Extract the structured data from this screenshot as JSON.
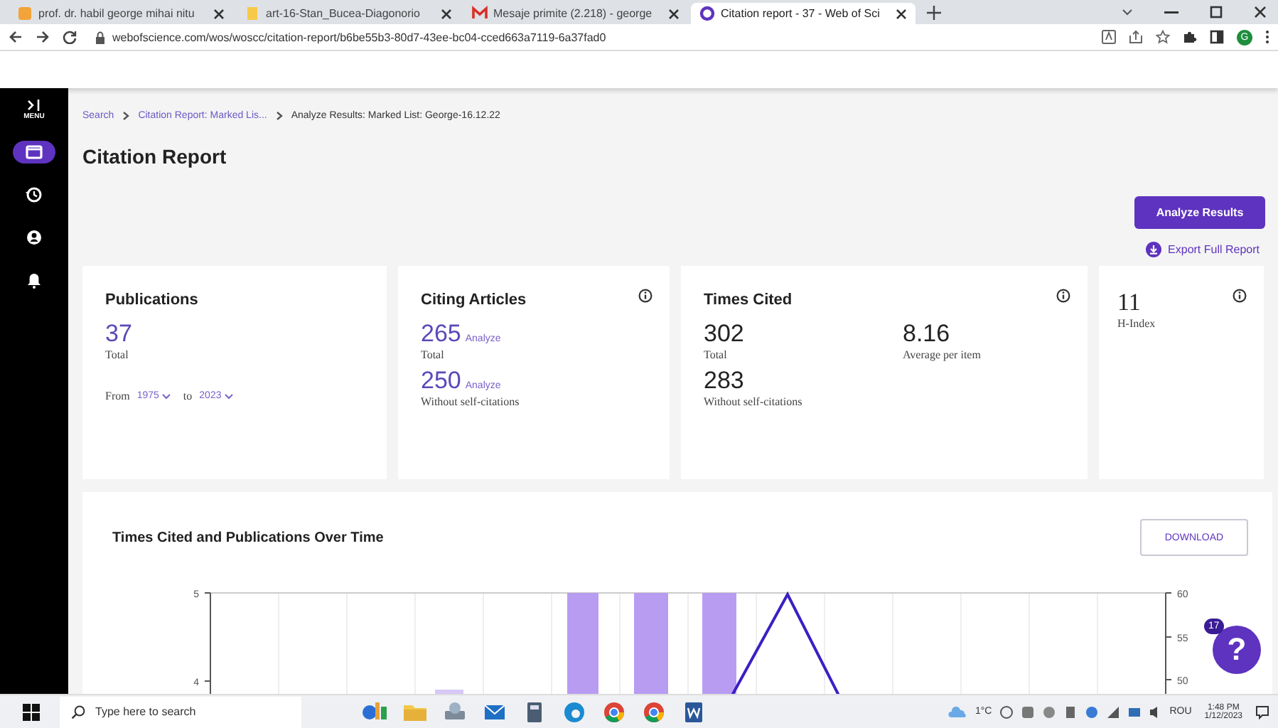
{
  "browser": {
    "tabs": [
      {
        "title": "prof. dr. habil george mihai nitu",
        "selected": false
      },
      {
        "title": "art-16-Stan_Bucea-Diagonorio",
        "selected": false
      },
      {
        "title": "Mesaje primite (2.218) - george",
        "selected": false
      },
      {
        "title": "Citation report - 37 - Web of Sci",
        "selected": true
      }
    ],
    "url": "webofscience.com/wos/woscc/citation-report/b6be55b3-80d7-43ee-bc04-cced663a7119-6a37fad0",
    "profile": "G"
  },
  "sidebar": {
    "menu_label": "MENU",
    "items": [
      {
        "kind": "folder",
        "selected": true
      },
      {
        "kind": "history",
        "selected": false
      },
      {
        "kind": "user",
        "selected": false
      },
      {
        "kind": "bell",
        "selected": false
      }
    ]
  },
  "breadcrumbs": [
    {
      "text": "Search",
      "link": true
    },
    {
      "text": "Citation Report: Marked Lis...",
      "link": true
    },
    {
      "text": "Analyze Results: Marked List: George-16.12.22",
      "link": false
    }
  ],
  "title": "Citation Report",
  "analyze_button": "Analyze Results",
  "export_link": "Export Full Report",
  "cards": [
    {
      "kind": "publications",
      "title": "Publications",
      "info": false,
      "value": "37",
      "value_label": "Total",
      "from_label": "From",
      "from_year": "1975",
      "to_label": "to",
      "to_year": "2023"
    },
    {
      "kind": "metrics",
      "title": "Citing Articles",
      "info": true,
      "metrics": [
        {
          "value": "265",
          "action": "Analyze",
          "label": "Total"
        },
        {
          "value": "250",
          "action": "Analyze",
          "label": "Without self-citations"
        }
      ]
    },
    {
      "kind": "metrics",
      "title": "Times Cited",
      "info": true,
      "metrics": [
        {
          "value": "302",
          "label": "Total"
        },
        {
          "value": "8.16",
          "label": "Average per item"
        },
        {
          "value": "283",
          "label": "Without self-citations"
        }
      ]
    },
    {
      "kind": "single",
      "info": true,
      "value": "11",
      "label": "H-Index"
    }
  ],
  "chart": {
    "title": "Times Cited and Publications Over Time",
    "download": "DOWNLOAD",
    "left_ticks": [
      "5",
      "4"
    ],
    "right_ticks": [
      "60",
      "55",
      "50"
    ]
  },
  "help": {
    "badge": "17",
    "label": "?"
  },
  "taskbar": {
    "search_placeholder": "Type here to search",
    "temperature": "1°C",
    "language": "ROU",
    "time": "1:48 PM",
    "date": "1/12/2023"
  }
}
